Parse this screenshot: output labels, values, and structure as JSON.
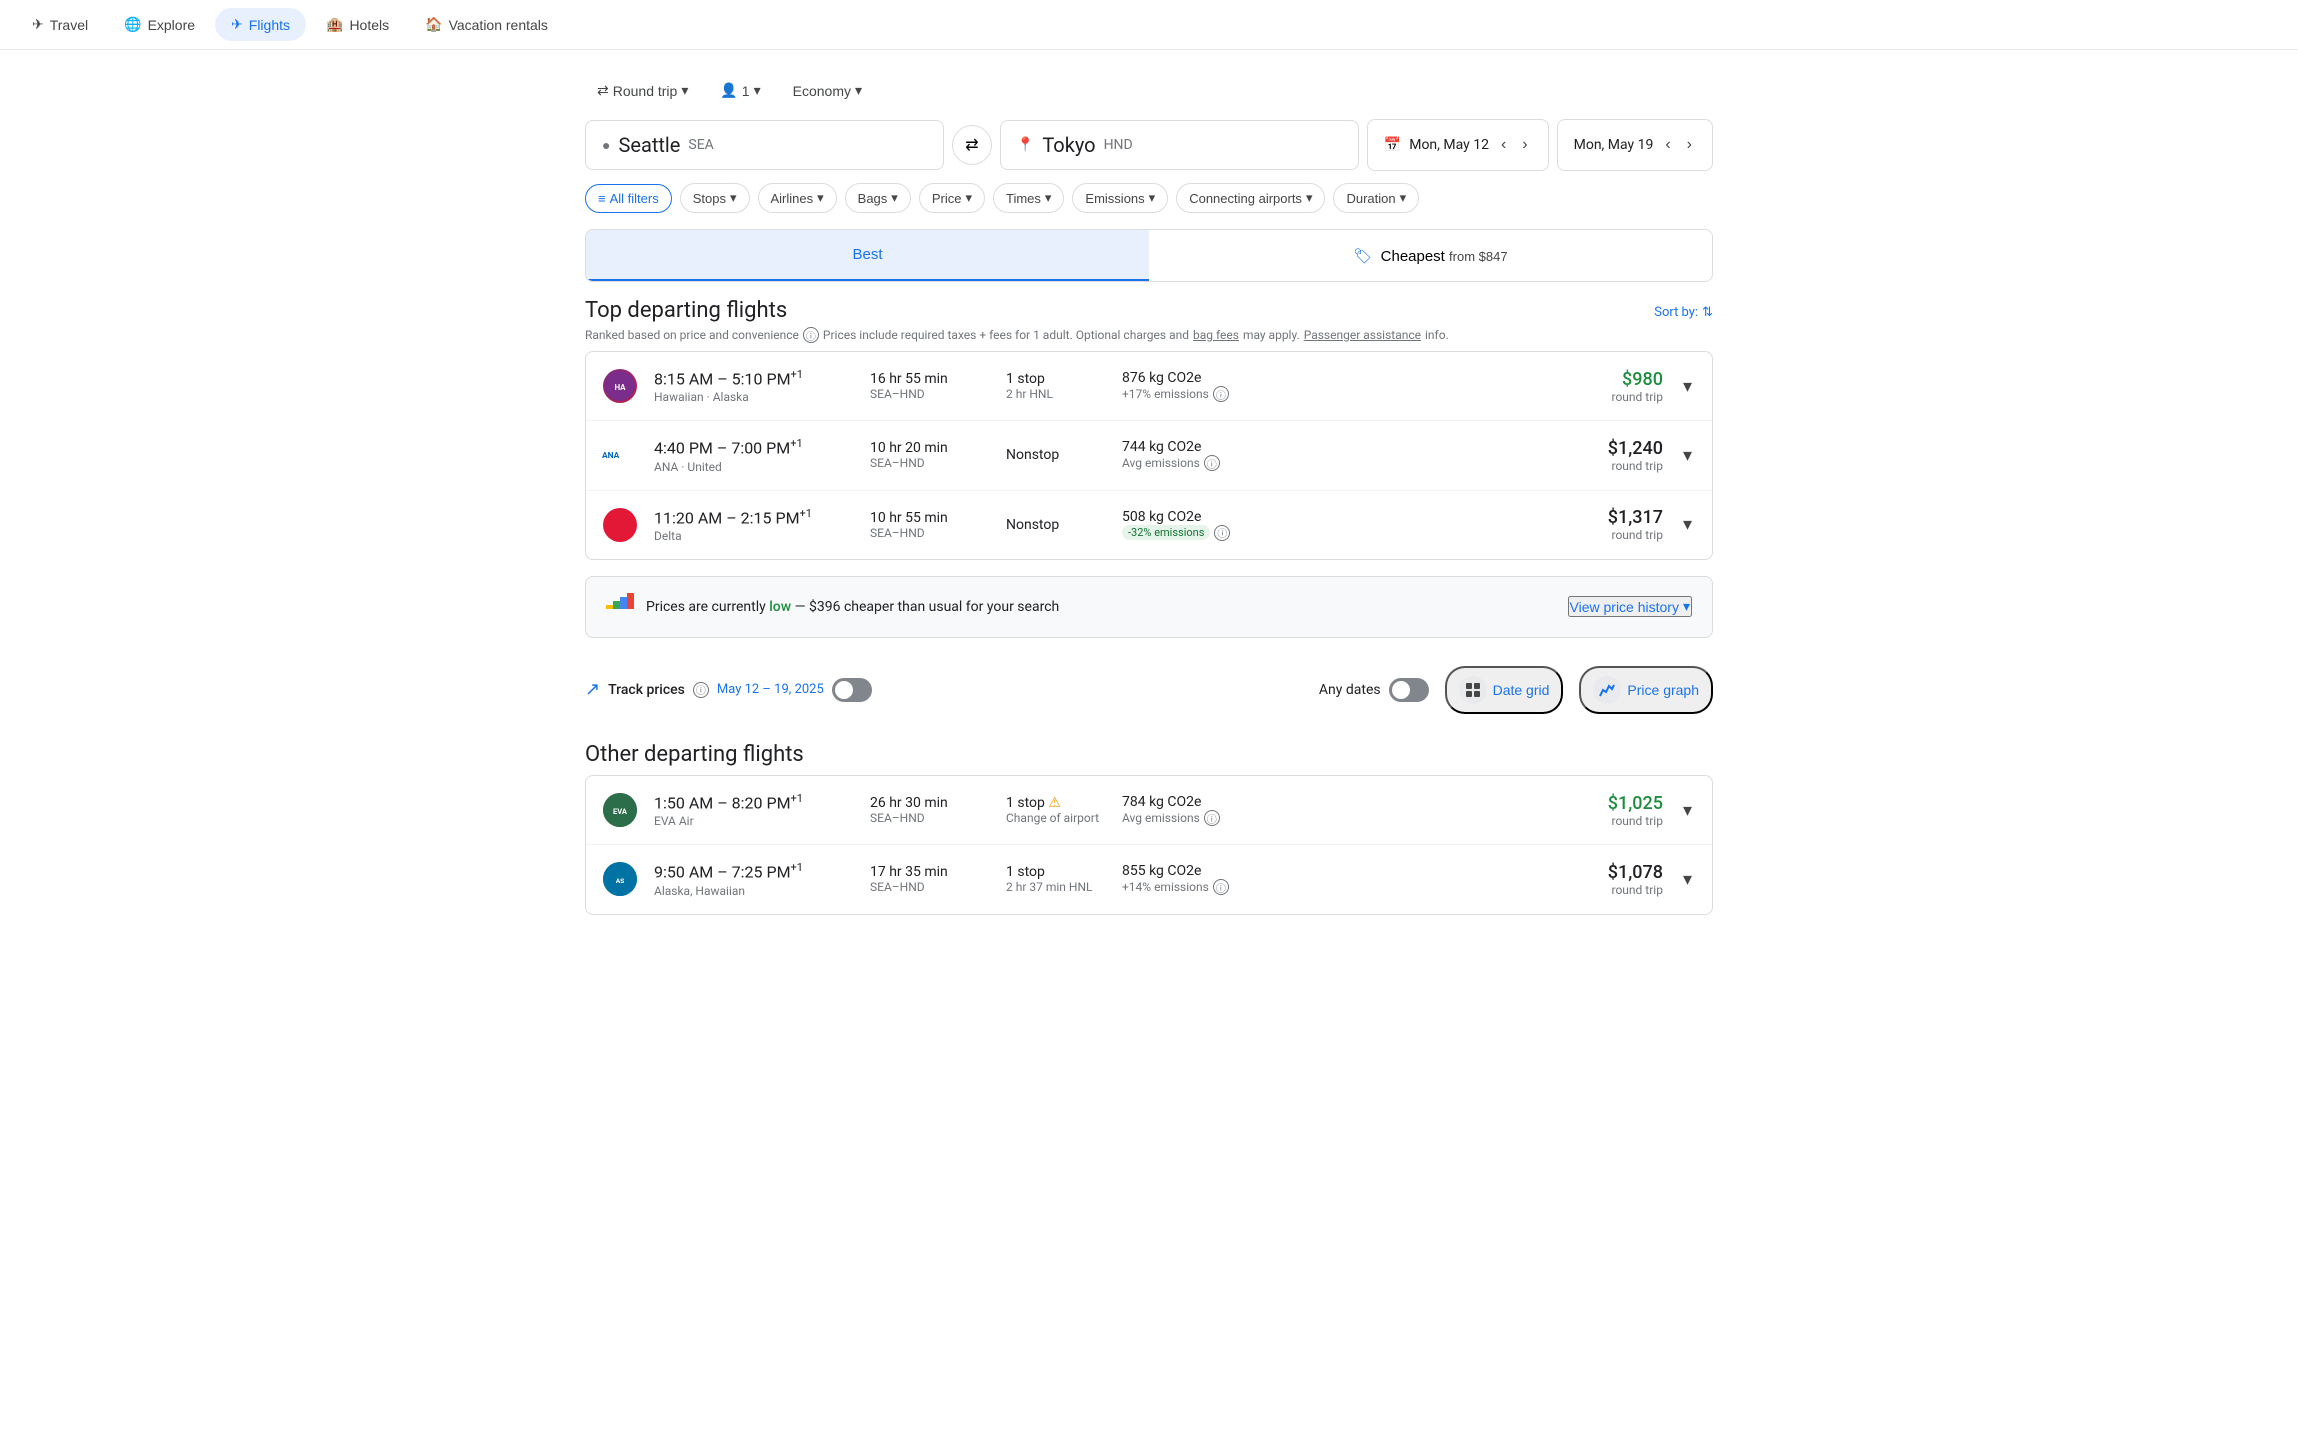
{
  "nav": {
    "items": [
      {
        "label": "Travel",
        "icon": "travel-icon",
        "active": false
      },
      {
        "label": "Explore",
        "icon": "explore-icon",
        "active": false
      },
      {
        "label": "Flights",
        "icon": "flights-icon",
        "active": true
      },
      {
        "label": "Hotels",
        "icon": "hotels-icon",
        "active": false
      },
      {
        "label": "Vacation rentals",
        "icon": "vacation-icon",
        "active": false
      }
    ]
  },
  "search": {
    "trip_type": "Round trip",
    "passengers": "1",
    "cabin": "Economy",
    "origin": "Seattle",
    "origin_iata": "SEA",
    "destination": "Tokyo",
    "destination_iata": "HND",
    "depart_date": "Mon, May 12",
    "return_date": "Mon, May 19"
  },
  "filters": {
    "all_filters": "All filters",
    "stops": "Stops",
    "airlines": "Airlines",
    "bags": "Bags",
    "price": "Price",
    "times": "Times",
    "emissions": "Emissions",
    "connecting_airports": "Connecting airports",
    "duration": "Duration"
  },
  "sort_tabs": {
    "best": "Best",
    "cheapest": "Cheapest",
    "cheapest_from": "from",
    "cheapest_price": "$847"
  },
  "top_flights": {
    "title": "Top departing flights",
    "subtitle": "Ranked based on price and convenience",
    "prices_note": "Prices include required taxes + fees for 1 adult. Optional charges and",
    "bag_fees": "bag fees",
    "may_apply": "may apply.",
    "passenger_assistance": "Passenger assistance",
    "info": "info.",
    "sort_by": "Sort by:",
    "flights": [
      {
        "time": "8:15 AM – 5:10 PM",
        "superscript": "+1",
        "airline": "Hawaiian · Alaska",
        "duration": "16 hr 55 min",
        "route": "SEA–HND",
        "stops": "1 stop",
        "stop_detail": "2 hr HNL",
        "co2": "876 kg CO2e",
        "emission_tag": "+17% emissions",
        "emission_type": "warning",
        "price": "$980",
        "price_color": "green",
        "trip_type": "round trip",
        "logo_type": "hawaiian"
      },
      {
        "time": "4:40 PM – 7:00 PM",
        "superscript": "+1",
        "airline": "ANA · United",
        "duration": "10 hr 20 min",
        "route": "SEA–HND",
        "stops": "Nonstop",
        "stop_detail": "",
        "co2": "744 kg CO2e",
        "emission_tag": "Avg emissions",
        "emission_type": "normal",
        "price": "$1,240",
        "price_color": "normal",
        "trip_type": "round trip",
        "logo_type": "ana"
      },
      {
        "time": "11:20 AM – 2:15 PM",
        "superscript": "+1",
        "airline": "Delta",
        "duration": "10 hr 55 min",
        "route": "SEA–HND",
        "stops": "Nonstop",
        "stop_detail": "",
        "co2": "508 kg CO2e",
        "emission_tag": "-32% emissions",
        "emission_type": "green",
        "price": "$1,317",
        "price_color": "normal",
        "trip_type": "round trip",
        "logo_type": "delta"
      }
    ]
  },
  "price_banner": {
    "text_before": "Prices are currently",
    "low_label": "low",
    "text_after": "— $396 cheaper than usual for your search",
    "view_history": "View price history"
  },
  "track_prices": {
    "label": "Track prices",
    "date_range": "May 12 – 19, 2025",
    "any_dates": "Any dates"
  },
  "view_options": {
    "date_grid": "Date grid",
    "price_graph": "Price graph"
  },
  "other_flights": {
    "title": "Other departing flights",
    "flights": [
      {
        "time": "1:50 AM – 8:20 PM",
        "superscript": "+1",
        "airline": "EVA Air",
        "duration": "26 hr 30 min",
        "route": "SEA–HND",
        "stops": "1 stop",
        "stop_detail": "Change of airport",
        "has_warning": true,
        "co2": "784 kg CO2e",
        "emission_tag": "Avg emissions",
        "emission_type": "normal",
        "price": "$1,025",
        "price_color": "green",
        "trip_type": "round trip",
        "logo_type": "eva"
      },
      {
        "time": "9:50 AM – 7:25 PM",
        "superscript": "+1",
        "airline": "Alaska, Hawaiian",
        "duration": "17 hr 35 min",
        "route": "SEA–HND",
        "stops": "1 stop",
        "stop_detail": "2 hr 37 min HNL",
        "has_warning": false,
        "co2": "855 kg CO2e",
        "emission_tag": "+14% emissions",
        "emission_type": "warning",
        "price": "$1,078",
        "price_color": "normal",
        "trip_type": "round trip",
        "logo_type": "alaska"
      }
    ]
  }
}
